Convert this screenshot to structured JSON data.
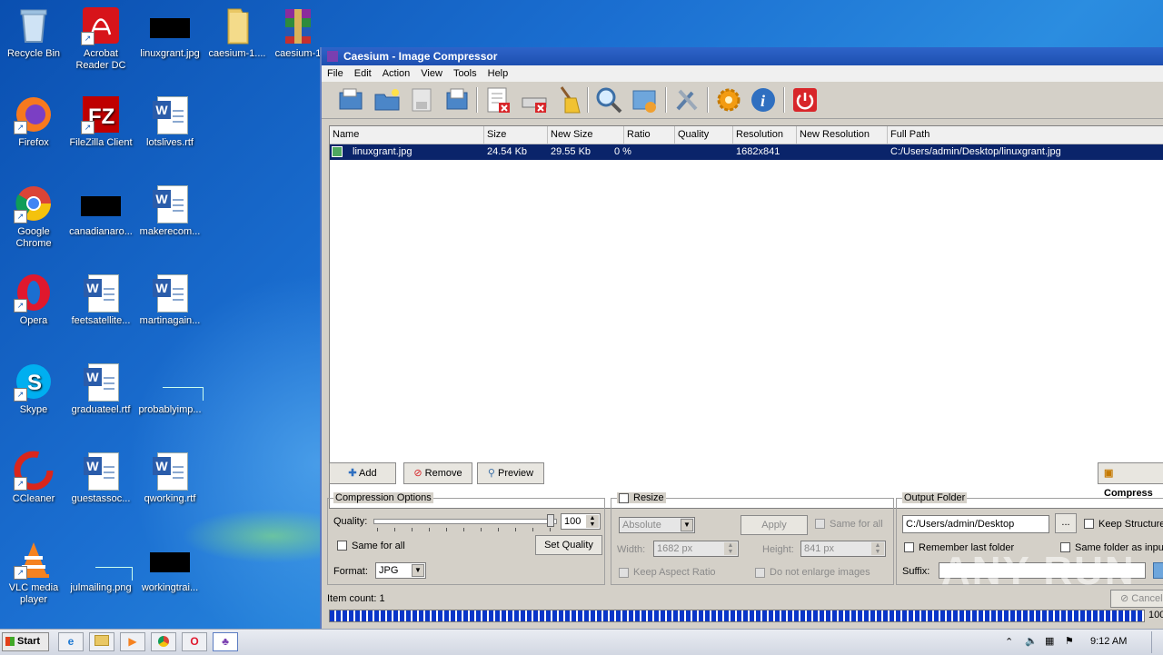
{
  "desktop": {
    "icons": [
      {
        "label": "Recycle Bin"
      },
      {
        "label": "Acrobat Reader DC"
      },
      {
        "label": "linuxgrant.jpg"
      },
      {
        "label": "caesium-1...."
      },
      {
        "label": "caesium-1"
      },
      {
        "label": "Firefox"
      },
      {
        "label": "FileZilla Client"
      },
      {
        "label": "lotslives.rtf"
      },
      {
        "label": "Google Chrome"
      },
      {
        "label": "canadianaro..."
      },
      {
        "label": "makerecom..."
      },
      {
        "label": "Opera"
      },
      {
        "label": "feetsatellite..."
      },
      {
        "label": "martinagain..."
      },
      {
        "label": "Skype"
      },
      {
        "label": "graduateel.rtf"
      },
      {
        "label": "probablyimp..."
      },
      {
        "label": "CCleaner"
      },
      {
        "label": "guestassoc..."
      },
      {
        "label": "qworking.rtf"
      },
      {
        "label": "VLC media player"
      },
      {
        "label": "julmailing.png"
      },
      {
        "label": "workingtrai..."
      }
    ]
  },
  "window": {
    "title": "Caesium - Image Compressor",
    "menu": [
      "File",
      "Edit",
      "Action",
      "View",
      "Tools",
      "Help"
    ],
    "toolbar_icons": [
      "open-file-icon",
      "open-folder-icon",
      "save-icon",
      "save-as-icon",
      "remove-item-icon",
      "clear-list-icon",
      "clean-icon",
      "search-icon",
      "preview-icon",
      "settings-icon",
      "updates-icon",
      "info-icon",
      "exit-icon"
    ],
    "columns": [
      "Name",
      "Size",
      "New Size",
      "Ratio",
      "Quality",
      "Resolution",
      "New Resolution",
      "Full Path"
    ],
    "rows": [
      {
        "name": "linuxgrant.jpg",
        "size": "24.54 Kb",
        "new_size": "29.55 Kb",
        "ratio": "0 %",
        "quality": "",
        "resolution": "1682x841",
        "new_resolution": "",
        "path": "C:/Users/admin/Desktop/linuxgrant.jpg"
      }
    ],
    "buttons": {
      "add": "Add",
      "remove": "Remove",
      "preview": "Preview",
      "compress": "Compress"
    },
    "compression": {
      "title": "Compression Options",
      "quality_label": "Quality:",
      "quality_value": "100",
      "quality_level": 1.0,
      "same_for_all": "Same for all",
      "set_quality": "Set Quality",
      "format_label": "Format:",
      "format_value": "JPG"
    },
    "resize": {
      "title": "Resize",
      "mode": "Absolute",
      "apply": "Apply",
      "same_for_all": "Same for all",
      "width_label": "Width:",
      "width_value": "1682 px",
      "height_label": "Height:",
      "height_value": "841 px",
      "keep_aspect": "Keep Aspect Ratio",
      "no_enlarge": "Do not enlarge images"
    },
    "output": {
      "title": "Output Folder",
      "path": "C:/Users/admin/Desktop",
      "browse": "...",
      "keep_structure": "Keep Structure",
      "remember_last": "Remember last folder",
      "same_as_input": "Same folder as input",
      "suffix_label": "Suffix:",
      "suffix_value": ""
    },
    "status": {
      "item_count": "Item count: 1",
      "progress_text": "100",
      "progress_value": 1.0,
      "cancel": "Cancel"
    }
  },
  "watermark": "ANY RUN",
  "taskbar": {
    "start_label": "Start",
    "time": "9:12 AM"
  }
}
